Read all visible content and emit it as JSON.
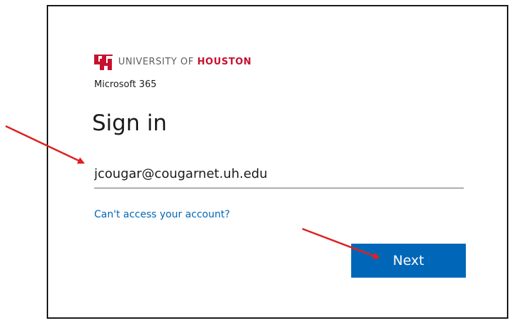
{
  "brand": {
    "prefix": "UNIVERSITY OF ",
    "name": "HOUSTON",
    "logo_icon": "uh-logo-icon",
    "color": "#c8102e"
  },
  "product": "Microsoft 365",
  "signin": {
    "title": "Sign in",
    "email_value": "jcougar@cougarnet.uh.edu",
    "cant_access_label": "Can't access your account?",
    "next_label": "Next"
  },
  "colors": {
    "accent": "#0067b8",
    "annotation_arrow": "#e02020"
  }
}
